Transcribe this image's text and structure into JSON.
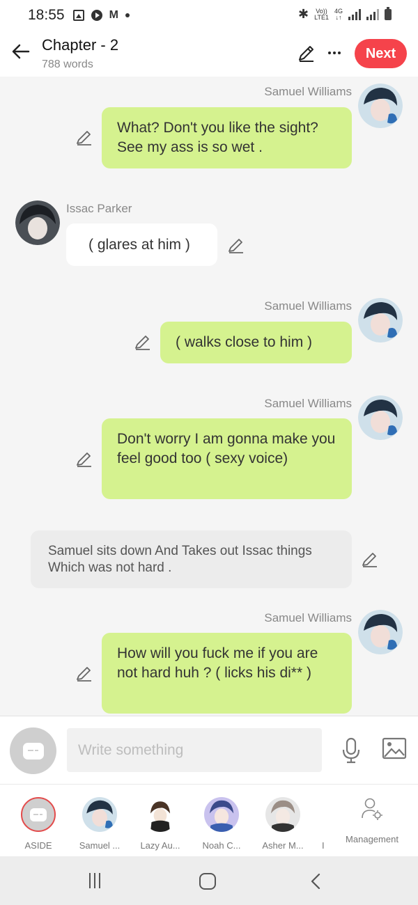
{
  "status_bar": {
    "time": "18:55",
    "left_icons": [
      "gallery-icon",
      "play-icon",
      "m-app-icon",
      "dot-icon"
    ],
    "volte": "Vo))",
    "lte": "LTE1",
    "network": "4G",
    "right_icons": [
      "bluetooth-icon",
      "signal-icon",
      "signal-icon",
      "battery-icon"
    ]
  },
  "header": {
    "title": "Chapter - 2",
    "subtitle": "788 words",
    "next_label": "Next",
    "icons": [
      "back-arrow-icon",
      "pencil-icon",
      "more-icon"
    ]
  },
  "messages": [
    {
      "type": "right",
      "speaker": "Samuel Williams",
      "text": "What? Don't you like the sight? See my ass is so wet ."
    },
    {
      "type": "left",
      "speaker": "Issac Parker",
      "text": "( glares at him )"
    },
    {
      "type": "right",
      "speaker": "Samuel Williams",
      "text": "( walks close to him )"
    },
    {
      "type": "right",
      "speaker": "Samuel Williams",
      "text": "Don't worry I am gonna make you feel good too ( sexy voice)"
    },
    {
      "type": "aside",
      "speaker": "",
      "text": "Samuel sits down And Takes out Issac things  Which was not hard ."
    },
    {
      "type": "right",
      "speaker": "Samuel Williams",
      "text": "How will you fuck me if you are not hard huh ? ( licks his di** )"
    }
  ],
  "composer": {
    "placeholder": "Write something",
    "icons": [
      "aside-chat-icon",
      "microphone-icon",
      "image-icon"
    ]
  },
  "characters": [
    {
      "label": "ASIDE",
      "selected": true,
      "icon": "aside-chat-icon"
    },
    {
      "label": "Samuel ...",
      "selected": false
    },
    {
      "label": "Lazy Au...",
      "selected": false
    },
    {
      "label": "Noah C...",
      "selected": false
    },
    {
      "label": "Asher M...",
      "selected": false
    },
    {
      "label": "I",
      "selected": false
    }
  ],
  "management": {
    "label": "Management",
    "icon": "user-gear-icon"
  },
  "nav": {
    "icons": [
      "recents-icon",
      "home-icon",
      "back-icon"
    ]
  },
  "colors": {
    "accent": "#f5434b",
    "bubble_green": "#d5f28f",
    "bubble_white": "#ffffff",
    "aside_gray": "#ececec",
    "background": "#f5f5f5"
  }
}
